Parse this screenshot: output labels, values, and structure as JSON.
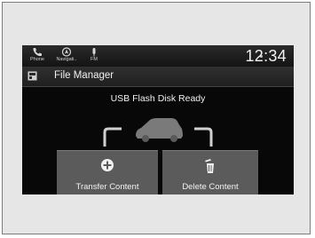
{
  "status_bar": {
    "items": [
      {
        "label": "Phone",
        "icon": "phone-icon"
      },
      {
        "label": "Navigati..",
        "icon": "navigation-icon"
      },
      {
        "label": "FM",
        "icon": "fm-radio-icon"
      }
    ],
    "clock": "12:34"
  },
  "title_bar": {
    "title": "File Manager",
    "icon": "file-manager-icon"
  },
  "main": {
    "status_message": "USB Flash Disk Ready"
  },
  "actions": {
    "transfer": {
      "label": "Transfer Content",
      "icon": "plus-circle-icon"
    },
    "delete": {
      "label": "Delete Content",
      "icon": "trash-icon"
    }
  }
}
